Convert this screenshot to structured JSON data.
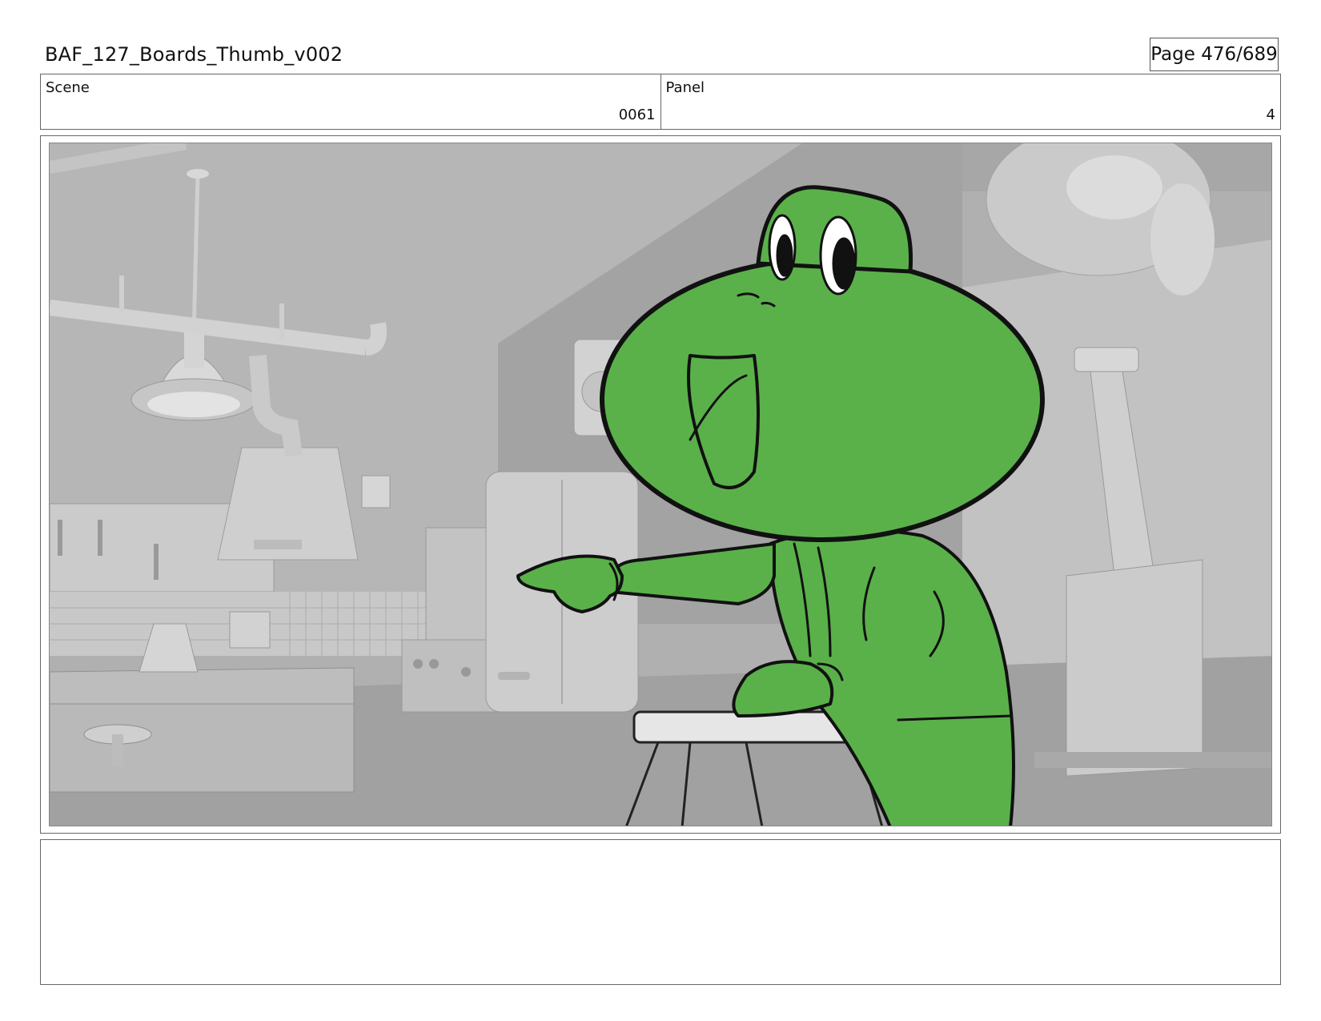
{
  "header": {
    "document_title": "BAF_127_Boards_Thumb_v002",
    "page_indicator": "Page 476/689"
  },
  "info": {
    "scene_label": "Scene",
    "scene_value": "0061",
    "panel_label": "Panel",
    "panel_value": "4"
  },
  "panel": {
    "character_color": "#5ab14a",
    "outline_color": "#111111",
    "background_color": "#b4b4b4"
  },
  "notes": {
    "text": ""
  }
}
